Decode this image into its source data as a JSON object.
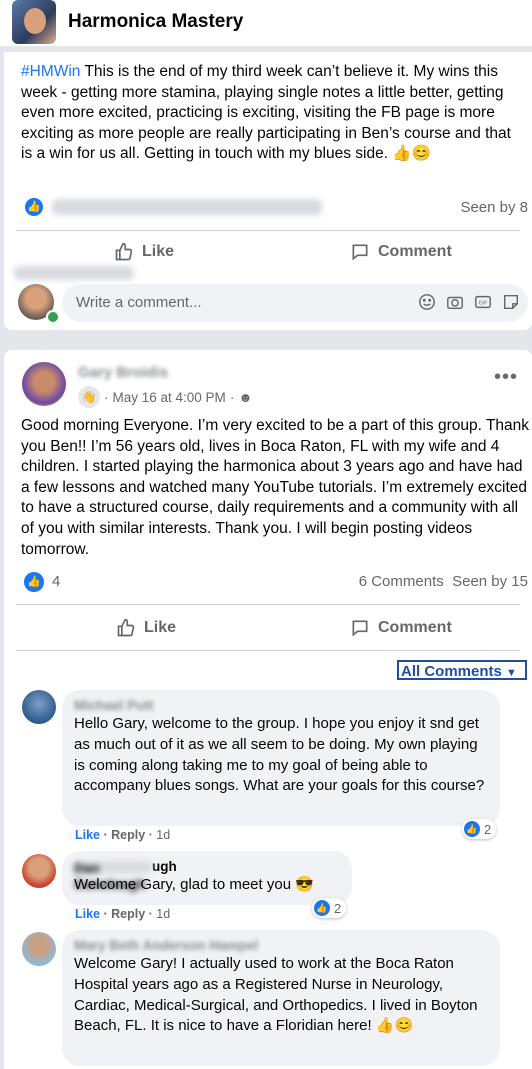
{
  "header": {
    "group_name": "Harmonica Mastery"
  },
  "post1": {
    "hashtag": "#HMWin",
    "body": " This is the end of my third week can’t believe it.  My wins this week - getting more stamina, playing single notes a little better, getting even more excited, practicing is exciting, visiting the FB page is more exciting as more people are really participating in Ben’s course and that is a win for us all.  Getting in touch with my blues side. 👍😊",
    "seen_by": "Seen by 8",
    "like_label": "Like",
    "comment_label": "Comment",
    "write_placeholder": "Write a comment...",
    "composer_icons": [
      "emoji-icon",
      "camera-icon",
      "gif-icon",
      "sticker-icon"
    ]
  },
  "post2": {
    "author": "Gary Broidis",
    "date": "May 16 at 4:00 PM",
    "body": "Good morning Everyone. I’m very excited to be a part of this group. Thank you Ben!! I’m 56 years old, lives in Boca Raton, FL with my wife and 4 children. I started playing the harmonica about 3 years ago and have had a few lessons and watched many YouTube tutorials. I’m extremely excited to have a structured course, daily requirements and a community with all of you with similar interests. Thank you. I will begin posting videos tomorrow.",
    "like_count": "4",
    "comments_count": "6 Comments",
    "seen_by": "Seen by 15",
    "like_label": "Like",
    "comment_label": "Comment",
    "filter_label": "All Comments"
  },
  "comments": [
    {
      "name": "Michael Putt",
      "text": "Hello Gary, welcome to the group. I hope you enjoy it snd get as much out of it as we all seem to be doing. My own playing is coming along taking me to my goal of being able to accompany blues songs. What are your goals for this course?",
      "like": "Like",
      "reply": "Reply",
      "time": "1d",
      "reactions": "2"
    },
    {
      "name": "Dan Conolough",
      "name_visible_suffix": "ugh",
      "text": "Welcome Gary, glad to meet you 😎",
      "like": "Like",
      "reply": "Reply",
      "time": "1d",
      "reactions": "2"
    },
    {
      "name": "Mary Beth Anderson Hampel",
      "text": "Welcome Gary! I actually used to work at the Boca Raton Hospital years ago as a Registered Nurse in Neurology, Cardiac, Medical-Surgical, and Orthopedics. I lived in Boyton Beach, FL. It is nice to have a Floridian here! 👍😊"
    }
  ],
  "colors": {
    "accent": "#1877f2",
    "muted": "#65676b",
    "bubble": "#f0f2f5"
  }
}
